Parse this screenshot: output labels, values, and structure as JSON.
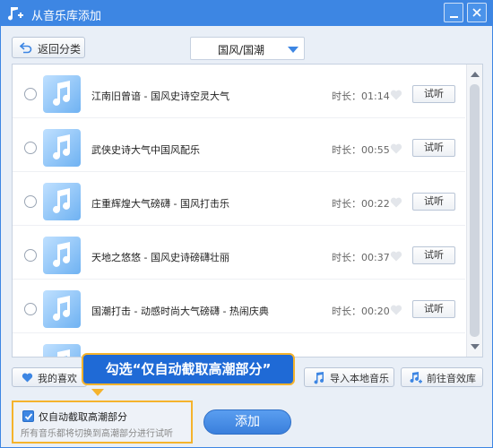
{
  "window": {
    "title": "从音乐库添加"
  },
  "toolbar": {
    "back_label": "返回分类",
    "category_value": "国风/国潮"
  },
  "songs": [
    {
      "title": "江南旧曾谙 - 国风史诗空灵大气",
      "duration": "时长：01:14",
      "listen": "试听"
    },
    {
      "title": "武侠史诗大气中国风配乐",
      "duration": "时长：00:55",
      "listen": "试听"
    },
    {
      "title": "庄重辉煌大气磅礴 - 国风打击乐",
      "duration": "时长：00:22",
      "listen": "试听"
    },
    {
      "title": "天地之悠悠 - 国风史诗磅礴壮丽",
      "duration": "时长：00:37",
      "listen": "试听"
    },
    {
      "title": "国潮打击 - 动感时尚大气磅礴 - 热闹庆典",
      "duration": "时长：00:20",
      "listen": "试听"
    }
  ],
  "footer": {
    "favorites_label": "我的喜欢",
    "import_local_label": "导入本地音乐",
    "goto_library_label": "前往音效库",
    "tooltip": "勾选“仅自动截取高潮部分”",
    "checkbox_label": "仅自动截取高潮部分",
    "checkbox_checked": true,
    "hint": "所有音乐都将切换到高潮部分进行试听",
    "add_label": "添加"
  },
  "colors": {
    "accent": "#3d86e3",
    "highlight_border": "#f5b32c",
    "tooltip_bg": "#1f6ad6"
  }
}
